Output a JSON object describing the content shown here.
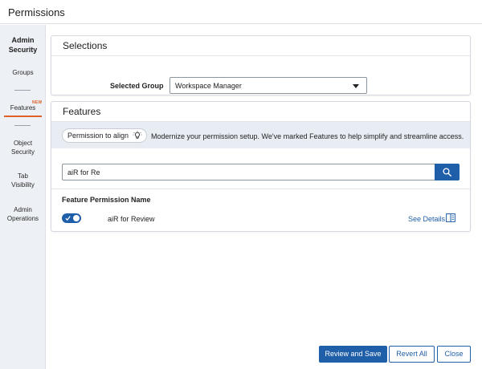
{
  "window": {
    "title": "Permissions"
  },
  "sidebar": {
    "heading_line1": "Admin",
    "heading_line2": "Security",
    "items": [
      {
        "label": "Groups"
      },
      {
        "label": "Features",
        "badge": "NEW",
        "active": true
      },
      {
        "label_line1": "Object",
        "label_line2": "Security"
      },
      {
        "label_line1": "Tab",
        "label_line2": "Visibility"
      },
      {
        "label_line1": "Admin",
        "label_line2": "Operations"
      }
    ]
  },
  "selections": {
    "title": "Selections",
    "group_label": "Selected Group",
    "group_value": "Workspace Manager"
  },
  "features": {
    "title": "Features",
    "chip_label": "Permission to align",
    "chip_icon": "lightbulb-icon",
    "info_text": "Modernize your permission setup. We've marked Features to help simplify and streamline access.",
    "search_value": "aiR for Re",
    "search_icon": "search-icon",
    "column_header": "Feature Permission Name",
    "rows": [
      {
        "name": "aiR for Review",
        "enabled": true,
        "details_label": "See Details",
        "details_icon": "book-icon"
      }
    ]
  },
  "footer": {
    "review_save": "Review and Save",
    "revert_all": "Revert All",
    "close": "Close"
  },
  "colors": {
    "accent": "#1f5ea8",
    "active_indicator": "#e0602a",
    "sidebar_bg": "#edf0f4",
    "info_band_bg": "#e8edf4"
  }
}
